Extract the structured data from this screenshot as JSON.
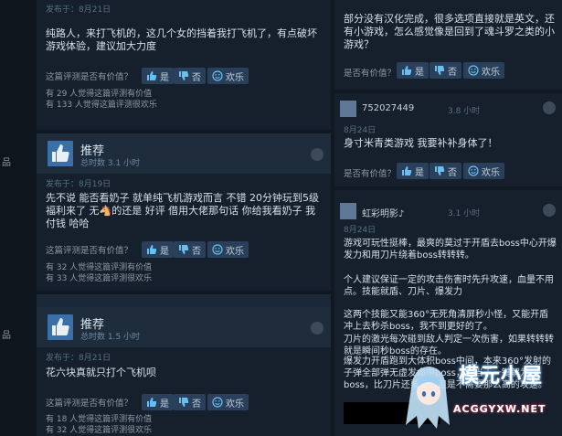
{
  "left": {
    "card1": {
      "date": "发布于：8月21日",
      "text": "纯路人，来打飞机的，这几个女的挡着我打飞机了，有点破坏游戏体验，建议加大力度",
      "question": "这篇评测是否有价值？",
      "yes": "是",
      "no": "否",
      "funny": "欢乐",
      "helpful1": "有 29 人觉得这篇评测有价值",
      "helpful2": "有 133 人觉得这篇评测很欢乐"
    },
    "card2": {
      "verdict": "推荐",
      "hours": "总时数 3.1 小时",
      "date": "发布于：8月19日",
      "text": "先不说 能否看奶子 就单纯飞机游戏而言 不错 20分钟玩到5级 福利来了 无🐴的还是 好评 借用大佬那句话 你给我看奶子 我付钱 哈哈",
      "question": "这篇评测是否有价值？",
      "yes": "是",
      "no": "否",
      "funny": "欢乐",
      "helpful1": "有 32 人觉得这篇评测有价值",
      "helpful2": "有 33 人觉得这篇评测很欢乐"
    },
    "card3": {
      "verdict": "推荐",
      "hours": "总时数 1.5 小时",
      "date": "发布于：8月21日",
      "text": "花六块真就只打个飞机呗",
      "question": "这篇评测是否有价值？",
      "yes": "是",
      "no": "否",
      "funny": "欢乐",
      "helpful1": "有 18 人觉得这篇评测有价值",
      "helpful2": "有 32 人觉得这篇评测很欢乐"
    },
    "strip": [
      "品",
      "品"
    ]
  },
  "right": {
    "card1": {
      "text": "部分没有汉化完成，很多选项直接就是英文，还有小游戏，怎么感觉像是回到了魂斗罗之类的小游戏？",
      "question": "是否有价值？",
      "yes": "是",
      "no": "否",
      "funny": "欢乐"
    },
    "card2": {
      "user": "752027449",
      "hours": "3.8 小时",
      "date": "8月24日",
      "text": "身寸米青类游戏 我要补补身体了！",
      "question": "是否有价值？",
      "yes": "是",
      "no": "否",
      "funny": "欢乐"
    },
    "card3": {
      "user": "虹彩明影♪",
      "hours": "3.1 小时",
      "date": "8月24日",
      "p1": "游戏可玩性挺棒，最爽的莫过于开盾去boss中心开爆发力和用刀片绕着boss转转转。",
      "p2": "个人建议保证一定的攻击伤害时先升攻速，血量不用点。技能就盾、刀片、爆发力",
      "p3": "这两个技能又能360°无死角清屏秒小怪，又能开盾冲上去秒杀boss，我不到更好的了。",
      "p4": "刀片的激光每次碰到敌人判定一次伤害，如果转转转就是瞬间秒boss的存在。",
      "p5": "爆发力开盾跑到大体积boss中间，本来360°发射的子弹全部弹无虚发命中boss，相当于一键解为boss，比刀片还要快，但是不需要那么高的攻速。"
    }
  },
  "watermark": {
    "title": "模元小屋",
    "url": "ACGGYXW.NET"
  },
  "colors": {
    "bg": "#1b2838",
    "card": "#16202d",
    "button": "#2a3f5a",
    "accent": "#66c0f4"
  }
}
